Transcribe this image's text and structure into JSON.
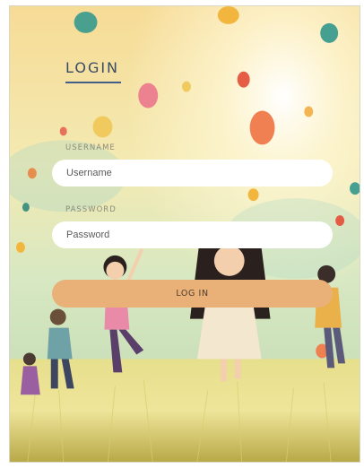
{
  "login_form": {
    "title": "LOGIN",
    "username": {
      "label": "USERNAME",
      "placeholder": "Username",
      "value": ""
    },
    "password": {
      "label": "PASSWORD",
      "placeholder": "Password",
      "value": ""
    },
    "submit_label": "LOG IN"
  },
  "colors": {
    "title": "#3b4a64",
    "title_underline": "#3f5f86",
    "button_fill": "#e9b177",
    "button_text": "#4e3d30",
    "input_fill": "#ffffff"
  }
}
